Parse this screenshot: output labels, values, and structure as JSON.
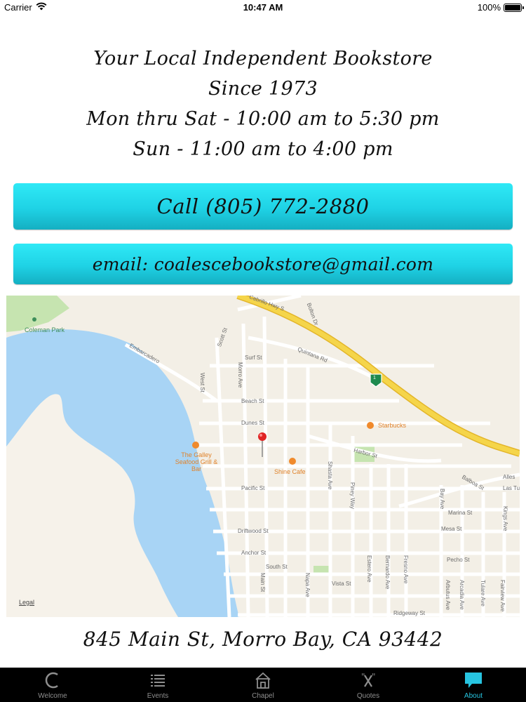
{
  "status_bar": {
    "carrier": "Carrier",
    "time": "10:47 AM",
    "battery": "100%"
  },
  "info": {
    "line1": "Your Local Independent Bookstore",
    "line2": "Since 1973",
    "line3": "Mon thru Sat - 10:00 am to 5:30 pm",
    "line4": "Sun - 11:00 am to 4:00 pm"
  },
  "buttons": {
    "call": "Call (805) 772-2880",
    "email": "email: coalescebookstore@gmail.com",
    "accent_color": "#22d6e8"
  },
  "map": {
    "streets": [
      "Cabrillo Hwy S",
      "Bolton Dr",
      "Quintana Rd",
      "Scott St",
      "Surf St",
      "West St",
      "Morro Ave",
      "Beach St",
      "Dunes St",
      "Harbor St",
      "Pacific St",
      "Driftwood St",
      "Anchor St",
      "South St",
      "Main St",
      "Napa Ave",
      "Vista St",
      "Shasta Ave",
      "Piney Way",
      "Estero Ave",
      "Bernardo Ave",
      "Fresno Ave",
      "Bay Ave",
      "Balboa St",
      "Marina St",
      "Mesa St",
      "Pecho St",
      "Kings Ave",
      "Arbutus Ave",
      "Arcadia Ave",
      "Tulare Ave",
      "Fairview Ave",
      "Ridgeway St",
      "Embarcadero",
      "Alles",
      "Las Tu"
    ],
    "pois": {
      "park": "Coleman Park",
      "starbucks": "Starbucks",
      "galley": "The Galley Seafood Grill & Bar",
      "shine": "Shine Cafe"
    },
    "route_shield": "1",
    "legal": "Legal"
  },
  "address": "845 Main St, Morro Bay, CA 93442",
  "tabs": [
    {
      "label": "Welcome",
      "icon": "c-logo-icon",
      "active": false
    },
    {
      "label": "Events",
      "icon": "list-icon",
      "active": false
    },
    {
      "label": "Chapel",
      "icon": "chapel-icon",
      "active": false
    },
    {
      "label": "Quotes",
      "icon": "quote-icon",
      "active": false
    },
    {
      "label": "About",
      "icon": "speech-bubble-icon",
      "active": true
    }
  ],
  "colors": {
    "tab_active": "#27c4e0",
    "tab_inactive": "#8e8e8e",
    "highway": "#f5d54a",
    "water": "#a8d4f5"
  }
}
